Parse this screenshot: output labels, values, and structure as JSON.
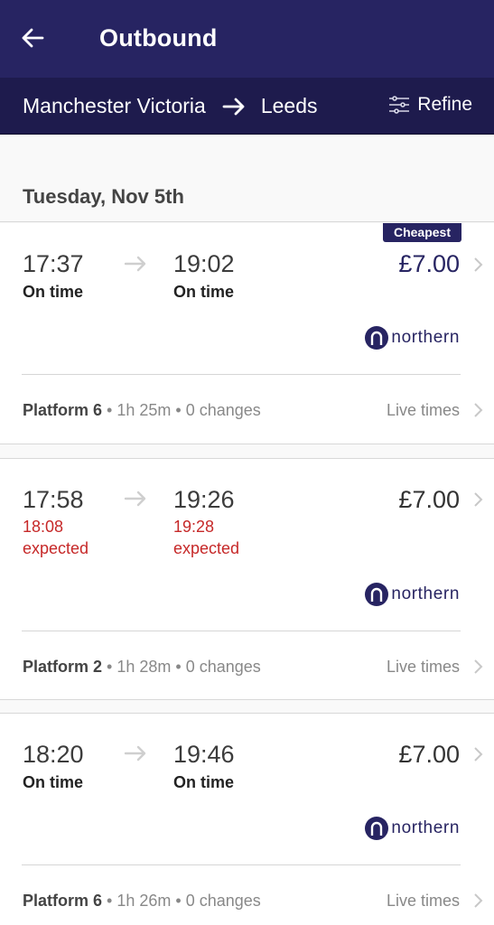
{
  "header": {
    "title": "Outbound",
    "back_icon": "arrow-left-icon"
  },
  "route": {
    "origin": "Manchester Victoria",
    "destination": "Leeds",
    "arrow_icon": "arrow-right-icon",
    "refine_label": "Refine",
    "refine_icon": "sliders-icon"
  },
  "date": "Tuesday, Nov 5th",
  "colors": {
    "brand": "#272462",
    "delay": "#c62828"
  },
  "journeys": [
    {
      "badge": "Cheapest",
      "departure": "17:37",
      "arrival": "19:02",
      "departure_status": "On time",
      "arrival_status": "On time",
      "price": "£7.00",
      "operator": "northern",
      "platform": "Platform 6",
      "duration": "1h 25m",
      "changes": "0 changes",
      "live_times": "Live times"
    },
    {
      "departure": "17:58",
      "arrival": "19:26",
      "departure_expected": "18:08",
      "arrival_expected": "19:28",
      "expected_label": "expected",
      "price": "£7.00",
      "operator": "northern",
      "platform": "Platform 2",
      "duration": "1h 28m",
      "changes": "0 changes",
      "live_times": "Live times"
    },
    {
      "departure": "18:20",
      "arrival": "19:46",
      "departure_status": "On time",
      "arrival_status": "On time",
      "price": "£7.00",
      "operator": "northern",
      "platform": "Platform 6",
      "duration": "1h 26m",
      "changes": "0 changes",
      "live_times": "Live times"
    }
  ],
  "separator": " • "
}
